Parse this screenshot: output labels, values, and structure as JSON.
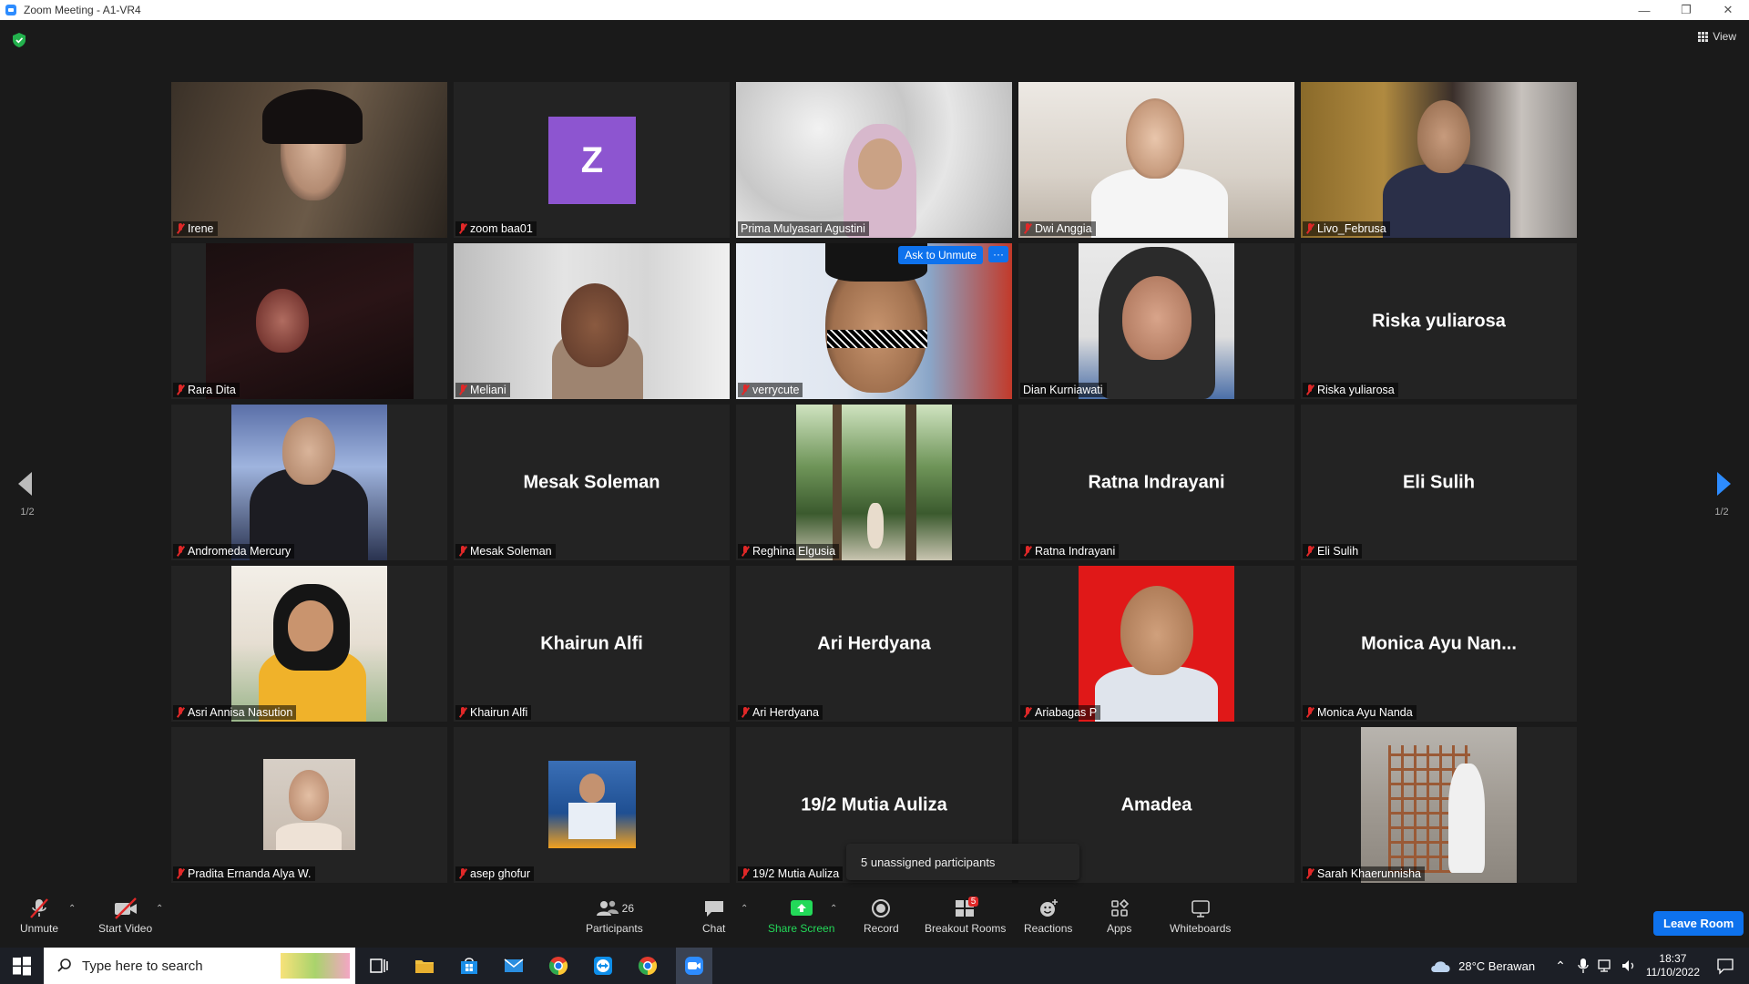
{
  "window": {
    "title": "Zoom Meeting - A1-VR4",
    "minimize": "—",
    "restore": "❐",
    "close": "✕"
  },
  "header": {
    "view_label": "View"
  },
  "pagination": {
    "left": "1/2",
    "right": "1/2"
  },
  "tiles": [
    {
      "name": "Irene",
      "type": "video",
      "muted": true
    },
    {
      "name": "zoom baa01",
      "type": "avatar",
      "initial": "Z",
      "muted": true
    },
    {
      "name": "Prima Mulyasari Agustini",
      "type": "video",
      "muted": false,
      "speaking": true
    },
    {
      "name": "Dwi Anggia",
      "type": "video",
      "muted": true
    },
    {
      "name": "Livo_Februsa",
      "type": "video",
      "muted": true
    },
    {
      "name": "Rara Dita",
      "type": "video",
      "muted": true
    },
    {
      "name": "Meliani",
      "type": "video",
      "muted": true
    },
    {
      "name": "verrycute",
      "type": "video",
      "muted": true,
      "ask_unmute": "Ask to Unmute",
      "more": "···"
    },
    {
      "name": "Dian Kurniawati",
      "type": "video",
      "muted": false
    },
    {
      "name": "Riska yuliarosa",
      "type": "name",
      "display": "Riska yuliarosa",
      "muted": true
    },
    {
      "name": "Andromeda Mercury",
      "type": "video",
      "muted": true
    },
    {
      "name": "Mesak Soleman",
      "type": "name",
      "display": "Mesak Soleman",
      "muted": true
    },
    {
      "name": "Reghina Elgusia",
      "type": "video",
      "muted": true
    },
    {
      "name": "Ratna Indrayani",
      "type": "name",
      "display": "Ratna Indrayani",
      "muted": true
    },
    {
      "name": "Eli Sulih",
      "type": "name",
      "display": "Eli Sulih",
      "muted": true
    },
    {
      "name": "Asri Annisa Nasution",
      "type": "video",
      "muted": true
    },
    {
      "name": "Khairun Alfi",
      "type": "name",
      "display": "Khairun Alfi",
      "muted": true
    },
    {
      "name": "Ari Herdyana",
      "type": "name",
      "display": "Ari Herdyana",
      "muted": true
    },
    {
      "name": "Ariabagas P",
      "type": "video",
      "muted": true
    },
    {
      "name": "Monica Ayu Nanda",
      "type": "name",
      "display": "Monica  Ayu  Nan...",
      "muted": true
    },
    {
      "name": "Pradita Ernanda Alya W.",
      "type": "video",
      "muted": true
    },
    {
      "name": "asep ghofur",
      "type": "video",
      "muted": true
    },
    {
      "name": "19/2 Mutia Auliza",
      "type": "name",
      "display": "19/2 Mutia Auliza",
      "muted": true
    },
    {
      "name": "",
      "type": "name",
      "display": "Amadea",
      "muted": false
    },
    {
      "name": "Sarah Khaerunnisha",
      "type": "video",
      "muted": true
    }
  ],
  "popup": {
    "text": "5 unassigned participants"
  },
  "toolbar": {
    "unmute": "Unmute",
    "start_video": "Start Video",
    "participants": "Participants",
    "participants_count": "26",
    "chat": "Chat",
    "share_screen": "Share Screen",
    "record": "Record",
    "breakout_rooms": "Breakout Rooms",
    "breakout_badge": "5",
    "reactions": "Reactions",
    "apps": "Apps",
    "whiteboards": "Whiteboards",
    "leave_room": "Leave Room"
  },
  "taskbar": {
    "search_placeholder": "Type here to search",
    "weather": "28°C  Berawan",
    "time": "18:37",
    "date": "11/10/2022"
  },
  "colors": {
    "accent": "#0e72ed",
    "share_green": "#23d959",
    "muted_red": "#e02828",
    "speaking_border": "#f3e33a"
  }
}
